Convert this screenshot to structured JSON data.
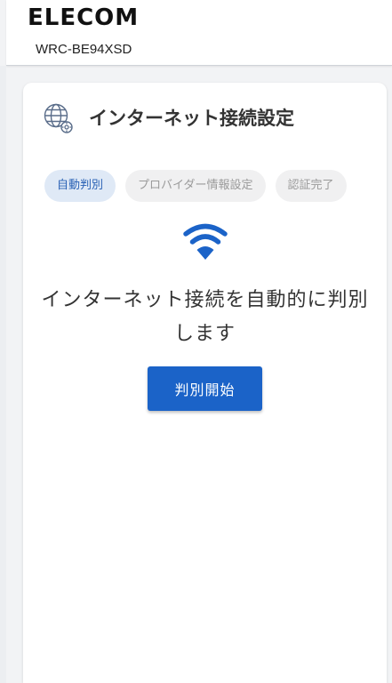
{
  "header": {
    "brand": "ELECOM",
    "model": "WRC-BE94XSD"
  },
  "card": {
    "icon": "globe-settings-icon",
    "title": "インターネット接続設定",
    "steps": [
      {
        "label": "自動判別",
        "state": "active"
      },
      {
        "label": "プロバイダー情報設定",
        "state": "inactive"
      },
      {
        "label": "認証完了",
        "state": "inactive"
      }
    ],
    "status_icon": "wifi-icon",
    "message": "インターネット接続を自動的に判別します",
    "start_button_label": "判別開始"
  },
  "colors": {
    "accent": "#1b63c8",
    "active_step_bg": "#dfe9f6",
    "active_step_text": "#2a62b5",
    "inactive_step_bg": "#f0f0f1",
    "inactive_step_text": "#9a9a9a",
    "wifi": "#1b63c8"
  }
}
